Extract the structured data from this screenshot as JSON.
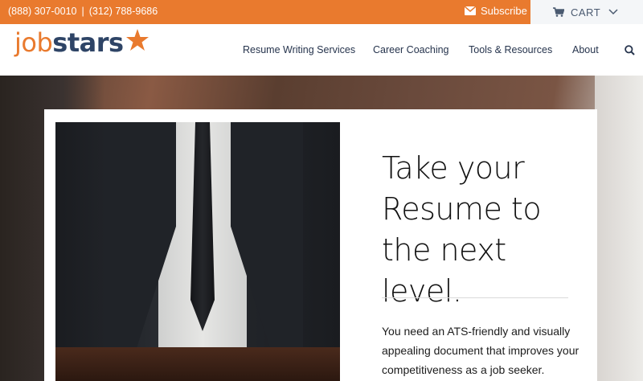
{
  "topbar": {
    "phone1": "(888) 307-0010",
    "separator": "|",
    "phone2": "(312) 788-9686",
    "subscribe_label": "Subscribe",
    "cart_label": "CART",
    "accent_color": "#e97a2e"
  },
  "header": {
    "logo_job": "job",
    "logo_stars": "stars",
    "nav": [
      {
        "label": "Resume Writing Services"
      },
      {
        "label": "Career Coaching"
      },
      {
        "label": "Tools & Resources"
      },
      {
        "label": "About"
      }
    ],
    "icons": {
      "search": "search-icon",
      "envelope": "envelope-icon",
      "cart": "cart-icon",
      "chevron": "chevron-down-icon",
      "star": "star-icon"
    }
  },
  "hero": {
    "headline_line1": "Take your",
    "headline_line2": "Resume to",
    "headline_line3": "the next level.",
    "body": "You need an ATS-friendly and visually appealing document that improves your competitiveness as a job seeker."
  }
}
